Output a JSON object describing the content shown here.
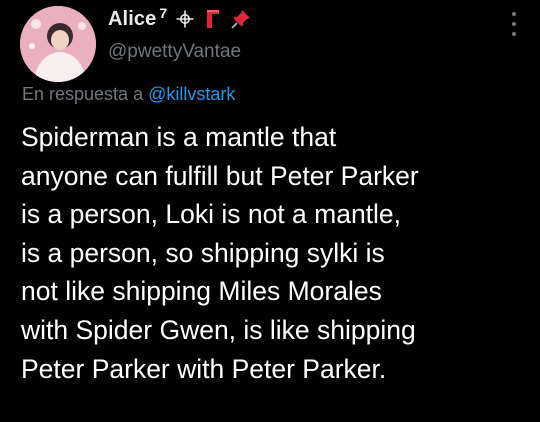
{
  "author": {
    "display_name": "Alice",
    "superscript": "7",
    "handle": "@pwettyVantae",
    "emoji_badges": [
      "compass-star-icon",
      "red-boot-icon",
      "red-pushpin-icon"
    ]
  },
  "reply": {
    "prefix": "En respuesta a",
    "mention": "@killvstark"
  },
  "tweet": {
    "lines": [
      "Spiderman is a mantle that",
      "anyone can fulfill but Peter Parker",
      "is a person, Loki is not a mantle,",
      "is a person, so shipping sylki is",
      "not like shipping Miles Morales",
      "with Spider Gwen, is like shipping",
      "Peter Parker with Peter Parker."
    ]
  },
  "colors": {
    "background": "#000000",
    "text": "#ffffff",
    "muted": "#71767b",
    "link": "#1d9bf0",
    "accent_red": "#e0243a"
  }
}
